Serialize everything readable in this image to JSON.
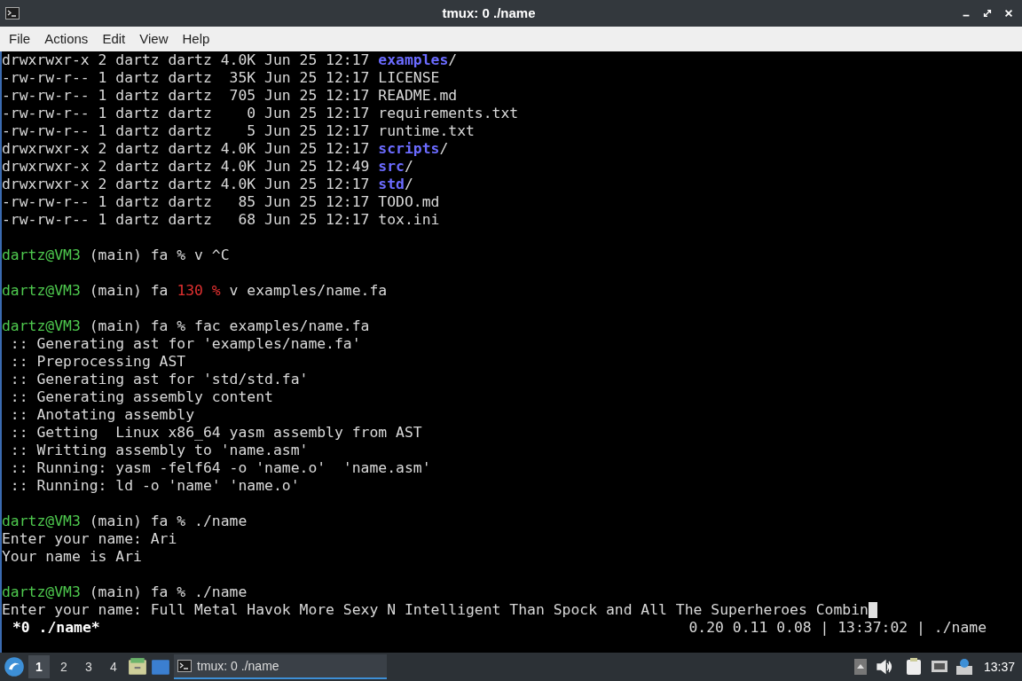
{
  "window": {
    "title": "tmux: 0 ./name"
  },
  "menu": [
    "File",
    "Actions",
    "Edit",
    "View",
    "Help"
  ],
  "terminal": {
    "lines": [
      {
        "kind": "text",
        "segments": [
          {
            "kind": "plain",
            "text": "drwxrwxr-x 2 dartz dartz 4.0K Jun 25 12:17 "
          },
          {
            "kind": "dir",
            "text": "examples"
          },
          {
            "kind": "plain",
            "text": "/"
          }
        ]
      },
      {
        "kind": "text",
        "segments": [
          {
            "kind": "plain",
            "text": "-rw-rw-r-- 1 dartz dartz  35K Jun 25 12:17 LICENSE"
          }
        ]
      },
      {
        "kind": "text",
        "segments": [
          {
            "kind": "plain",
            "text": "-rw-rw-r-- 1 dartz dartz  705 Jun 25 12:17 README.md"
          }
        ]
      },
      {
        "kind": "text",
        "segments": [
          {
            "kind": "plain",
            "text": "-rw-rw-r-- 1 dartz dartz    0 Jun 25 12:17 requirements.txt"
          }
        ]
      },
      {
        "kind": "text",
        "segments": [
          {
            "kind": "plain",
            "text": "-rw-rw-r-- 1 dartz dartz    5 Jun 25 12:17 runtime.txt"
          }
        ]
      },
      {
        "kind": "text",
        "segments": [
          {
            "kind": "plain",
            "text": "drwxrwxr-x 2 dartz dartz 4.0K Jun 25 12:17 "
          },
          {
            "kind": "dir",
            "text": "scripts"
          },
          {
            "kind": "plain",
            "text": "/"
          }
        ]
      },
      {
        "kind": "text",
        "segments": [
          {
            "kind": "plain",
            "text": "drwxrwxr-x 2 dartz dartz 4.0K Jun 25 12:49 "
          },
          {
            "kind": "dir",
            "text": "src"
          },
          {
            "kind": "plain",
            "text": "/"
          }
        ]
      },
      {
        "kind": "text",
        "segments": [
          {
            "kind": "plain",
            "text": "drwxrwxr-x 2 dartz dartz 4.0K Jun 25 12:17 "
          },
          {
            "kind": "dir",
            "text": "std"
          },
          {
            "kind": "plain",
            "text": "/"
          }
        ]
      },
      {
        "kind": "text",
        "segments": [
          {
            "kind": "plain",
            "text": "-rw-rw-r-- 1 dartz dartz   85 Jun 25 12:17 TODO.md"
          }
        ]
      },
      {
        "kind": "text",
        "segments": [
          {
            "kind": "plain",
            "text": "-rw-rw-r-- 1 dartz dartz   68 Jun 25 12:17 tox.ini"
          }
        ]
      },
      {
        "kind": "blank"
      },
      {
        "kind": "text",
        "segments": [
          {
            "kind": "user",
            "text": "dartz@VM3"
          },
          {
            "kind": "plain",
            "text": " (main) fa % v ^C"
          }
        ]
      },
      {
        "kind": "blank"
      },
      {
        "kind": "text",
        "segments": [
          {
            "kind": "user",
            "text": "dartz@VM3"
          },
          {
            "kind": "plain",
            "text": " (main) fa "
          },
          {
            "kind": "error",
            "text": "130 %"
          },
          {
            "kind": "plain",
            "text": " v examples/name.fa"
          }
        ]
      },
      {
        "kind": "blank"
      },
      {
        "kind": "text",
        "segments": [
          {
            "kind": "user",
            "text": "dartz@VM3"
          },
          {
            "kind": "plain",
            "text": " (main) fa % fac examples/name.fa"
          }
        ]
      },
      {
        "kind": "text",
        "segments": [
          {
            "kind": "plain",
            "text": " :: Generating ast for 'examples/name.fa'"
          }
        ]
      },
      {
        "kind": "text",
        "segments": [
          {
            "kind": "plain",
            "text": " :: Preprocessing AST"
          }
        ]
      },
      {
        "kind": "text",
        "segments": [
          {
            "kind": "plain",
            "text": " :: Generating ast for 'std/std.fa'"
          }
        ]
      },
      {
        "kind": "text",
        "segments": [
          {
            "kind": "plain",
            "text": " :: Generating assembly content"
          }
        ]
      },
      {
        "kind": "text",
        "segments": [
          {
            "kind": "plain",
            "text": " :: Anotating assembly"
          }
        ]
      },
      {
        "kind": "text",
        "segments": [
          {
            "kind": "plain",
            "text": " :: Getting  Linux x86_64 yasm assembly from AST"
          }
        ]
      },
      {
        "kind": "text",
        "segments": [
          {
            "kind": "plain",
            "text": " :: Writting assembly to 'name.asm'"
          }
        ]
      },
      {
        "kind": "text",
        "segments": [
          {
            "kind": "plain",
            "text": " :: Running: yasm -felf64 -o 'name.o'  'name.asm'"
          }
        ]
      },
      {
        "kind": "text",
        "segments": [
          {
            "kind": "plain",
            "text": " :: Running: ld -o 'name' 'name.o'"
          }
        ]
      },
      {
        "kind": "blank"
      },
      {
        "kind": "text",
        "segments": [
          {
            "kind": "user",
            "text": "dartz@VM3"
          },
          {
            "kind": "plain",
            "text": " (main) fa % ./name"
          }
        ]
      },
      {
        "kind": "text",
        "segments": [
          {
            "kind": "plain",
            "text": "Enter your name: Ari"
          }
        ]
      },
      {
        "kind": "text",
        "segments": [
          {
            "kind": "plain",
            "text": "Your name is Ari"
          }
        ]
      },
      {
        "kind": "blank"
      },
      {
        "kind": "text",
        "segments": [
          {
            "kind": "user",
            "text": "dartz@VM3"
          },
          {
            "kind": "plain",
            "text": " (main) fa % ./name"
          }
        ]
      },
      {
        "kind": "text",
        "cursor": true,
        "segments": [
          {
            "kind": "plain",
            "text": "Enter your name: Full Metal Havok More Sexy N Intelligent Than Spock and All The Superheroes Combin"
          }
        ]
      }
    ],
    "status_bar": {
      "window": "*0 ./name*",
      "info": "0.20 0.11 0.08 | 13:37:02 | ./name"
    }
  },
  "taskbar": {
    "workspaces": [
      {
        "label": "1",
        "selected": true
      },
      {
        "label": "2",
        "selected": false
      },
      {
        "label": "3",
        "selected": false
      },
      {
        "label": "4",
        "selected": false
      }
    ],
    "task": {
      "label": "tmux: 0 ./name",
      "selected": true
    },
    "clock": "13:37"
  }
}
